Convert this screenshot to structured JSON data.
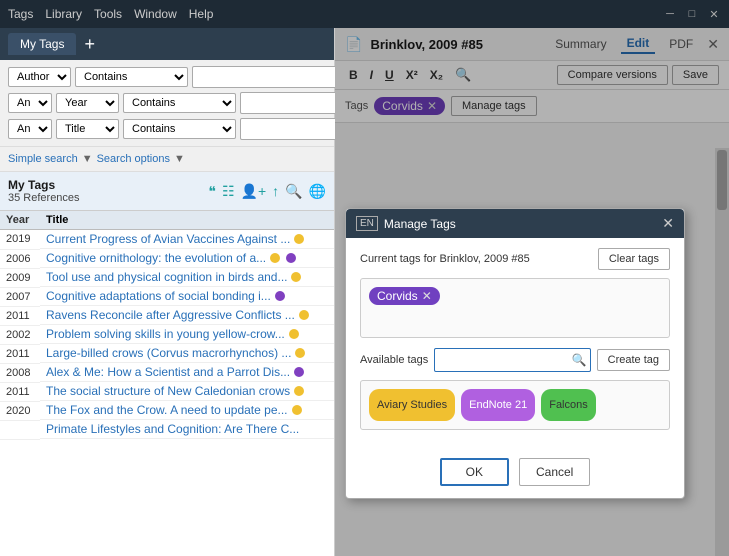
{
  "menubar": {
    "items": [
      "Tags",
      "Library",
      "Tools",
      "Window",
      "Help"
    ]
  },
  "left_panel": {
    "tab_label": "My Tags",
    "add_button": "+",
    "filters": [
      {
        "prefix": null,
        "field": "Author",
        "condition": "Contains",
        "value": ""
      },
      {
        "prefix": "And",
        "field": "Year",
        "condition": "Contains",
        "value": ""
      },
      {
        "prefix": "And",
        "field": "Title",
        "condition": "Contains",
        "value": ""
      }
    ],
    "search_mode": {
      "simple": "Simple search",
      "advanced": "Search options"
    },
    "mytags": {
      "title": "My Tags",
      "count": "35 References"
    },
    "mytags_icons": [
      "❝",
      "☷",
      "👤",
      "↑",
      "🔍",
      "🌐"
    ],
    "table": {
      "columns": [
        "Year",
        "Title"
      ],
      "rows": [
        {
          "year": "2019",
          "title": "Current Progress of Avian Vaccines Against ...",
          "tags": [
            "yellow"
          ]
        },
        {
          "year": "2006",
          "title": "Cognitive ornithology: the evolution of a...",
          "tags": [
            "yellow",
            "purple"
          ]
        },
        {
          "year": "2009",
          "title": "Tool use and physical cognition in birds and...",
          "tags": [
            "yellow"
          ]
        },
        {
          "year": "2007",
          "title": "Cognitive adaptations of social bonding i...",
          "tags": [
            "purple"
          ]
        },
        {
          "year": "2011",
          "title": "Ravens Reconcile after Aggressive Conflicts ...",
          "tags": [
            "yellow"
          ]
        },
        {
          "year": "2002",
          "title": "Problem solving skills in young yellow-crow...",
          "tags": [
            "yellow"
          ]
        },
        {
          "year": "2011",
          "title": "Large-billed crows (Corvus macrorhynchos) ...",
          "tags": [
            "yellow"
          ]
        },
        {
          "year": "2008",
          "title": "Alex & Me: How a Scientist and a Parrot Dis...",
          "tags": [
            "purple"
          ]
        },
        {
          "year": "2011",
          "title": "The social structure of New Caledonian crows",
          "tags": [
            "yellow"
          ]
        },
        {
          "year": "2020",
          "title": "The Fox and the Crow. A need to update pe...",
          "tags": [
            "yellow"
          ]
        },
        {
          "year": "",
          "title": "Primate Lifestyles and Cognition: Are There C...",
          "tags": []
        }
      ]
    }
  },
  "right_panel": {
    "ref_title": "Brinklov, 2009 #85",
    "tabs": [
      "Summary",
      "Edit",
      "PDF"
    ],
    "active_tab": "Edit",
    "editor_buttons": [
      "B",
      "I",
      "U",
      "X²",
      "X₂"
    ],
    "compare_label": "Compare versions",
    "save_label": "Save",
    "tags_label": "Tags",
    "current_tags": [
      {
        "label": "Corvids",
        "color": "#7040c0"
      }
    ],
    "manage_tags_label": "Manage tags"
  },
  "manage_tags_dialog": {
    "lang": "EN",
    "title": "Manage Tags",
    "current_tags_info": "Current tags for Brinklov, 2009 #85",
    "clear_tags_label": "Clear tags",
    "current_tags": [
      {
        "label": "Corvids",
        "color": "#7040c0"
      }
    ],
    "available_tags_label": "Available tags",
    "available_input_value": "",
    "available_input_placeholder": "",
    "create_tag_label": "Create tag",
    "available_tags": [
      {
        "label": "Aviary Studies",
        "color": "yellow"
      },
      {
        "label": "EndNote 21",
        "color": "purple"
      },
      {
        "label": "Falcons",
        "color": "green"
      }
    ],
    "ok_label": "OK",
    "cancel_label": "Cancel"
  }
}
